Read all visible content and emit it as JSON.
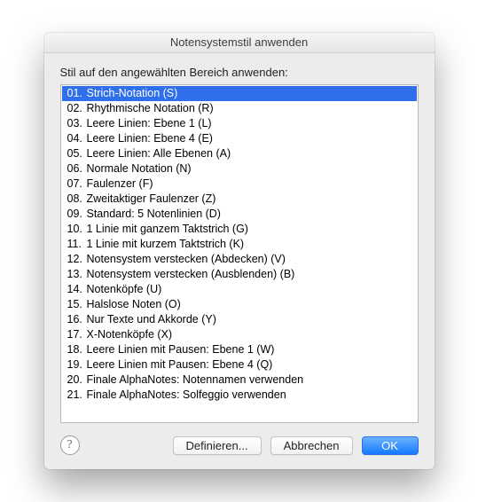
{
  "title": "Notensystemstil anwenden",
  "prompt": "Stil auf den angewählten Bereich anwenden:",
  "selected_index": 0,
  "items": [
    {
      "num": "01.",
      "label": "Strich-Notation (S)"
    },
    {
      "num": "02.",
      "label": "Rhythmische Notation (R)"
    },
    {
      "num": "03.",
      "label": "Leere Linien: Ebene 1 (L)"
    },
    {
      "num": "04.",
      "label": "Leere Linien: Ebene 4 (E)"
    },
    {
      "num": "05.",
      "label": "Leere Linien: Alle Ebenen (A)"
    },
    {
      "num": "06.",
      "label": "Normale Notation (N)"
    },
    {
      "num": "07.",
      "label": "Faulenzer (F)"
    },
    {
      "num": "08.",
      "label": "Zweitaktiger Faulenzer (Z)"
    },
    {
      "num": "09.",
      "label": "Standard: 5 Notenlinien (D)"
    },
    {
      "num": "10.",
      "label": "1 Linie mit ganzem Taktstrich (G)"
    },
    {
      "num": "11.",
      "label": "1 Linie mit kurzem Taktstrich (K)"
    },
    {
      "num": "12.",
      "label": "Notensystem verstecken (Abdecken) (V)"
    },
    {
      "num": "13.",
      "label": "Notensystem verstecken (Ausblenden) (B)"
    },
    {
      "num": "14.",
      "label": "Notenköpfe (U)"
    },
    {
      "num": "15.",
      "label": "Halslose Noten (O)"
    },
    {
      "num": "16.",
      "label": "Nur Texte und Akkorde (Y)"
    },
    {
      "num": "17.",
      "label": "X-Notenköpfe (X)"
    },
    {
      "num": "18.",
      "label": "Leere Linien mit Pausen: Ebene 1 (W)"
    },
    {
      "num": "19.",
      "label": "Leere Linien mit Pausen: Ebene 4 (Q)"
    },
    {
      "num": "20.",
      "label": "Finale AlphaNotes: Notennamen verwenden"
    },
    {
      "num": "21.",
      "label": "Finale AlphaNotes: Solfeggio verwenden"
    }
  ],
  "buttons": {
    "define": "Definieren...",
    "cancel": "Abbrechen",
    "ok": "OK"
  },
  "help": "?"
}
